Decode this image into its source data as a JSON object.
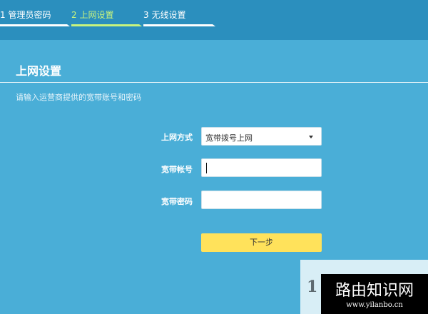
{
  "wizard": {
    "steps": [
      {
        "label": "1 管理员密码",
        "active": false
      },
      {
        "label": "2 上网设置",
        "active": true
      },
      {
        "label": "3 无线设置",
        "active": false
      }
    ]
  },
  "page": {
    "title": "上网设置",
    "hint": "请输入运营商提供的宽带账号和密码"
  },
  "form": {
    "connection_type": {
      "label": "上网方式",
      "value": "宽带拨号上网"
    },
    "account": {
      "label": "宽带帐号",
      "value": ""
    },
    "password": {
      "label": "宽带密码",
      "value": ""
    },
    "next_label": "下一步"
  },
  "watermark": {
    "partial_text": "1",
    "title": "路由知识网",
    "url": "www.yilanbo.cn"
  },
  "colors": {
    "background": "#4aaed7",
    "topbar": "#2b8fbe",
    "active_step": "#c8f47e",
    "next_button": "#ffe25b"
  }
}
